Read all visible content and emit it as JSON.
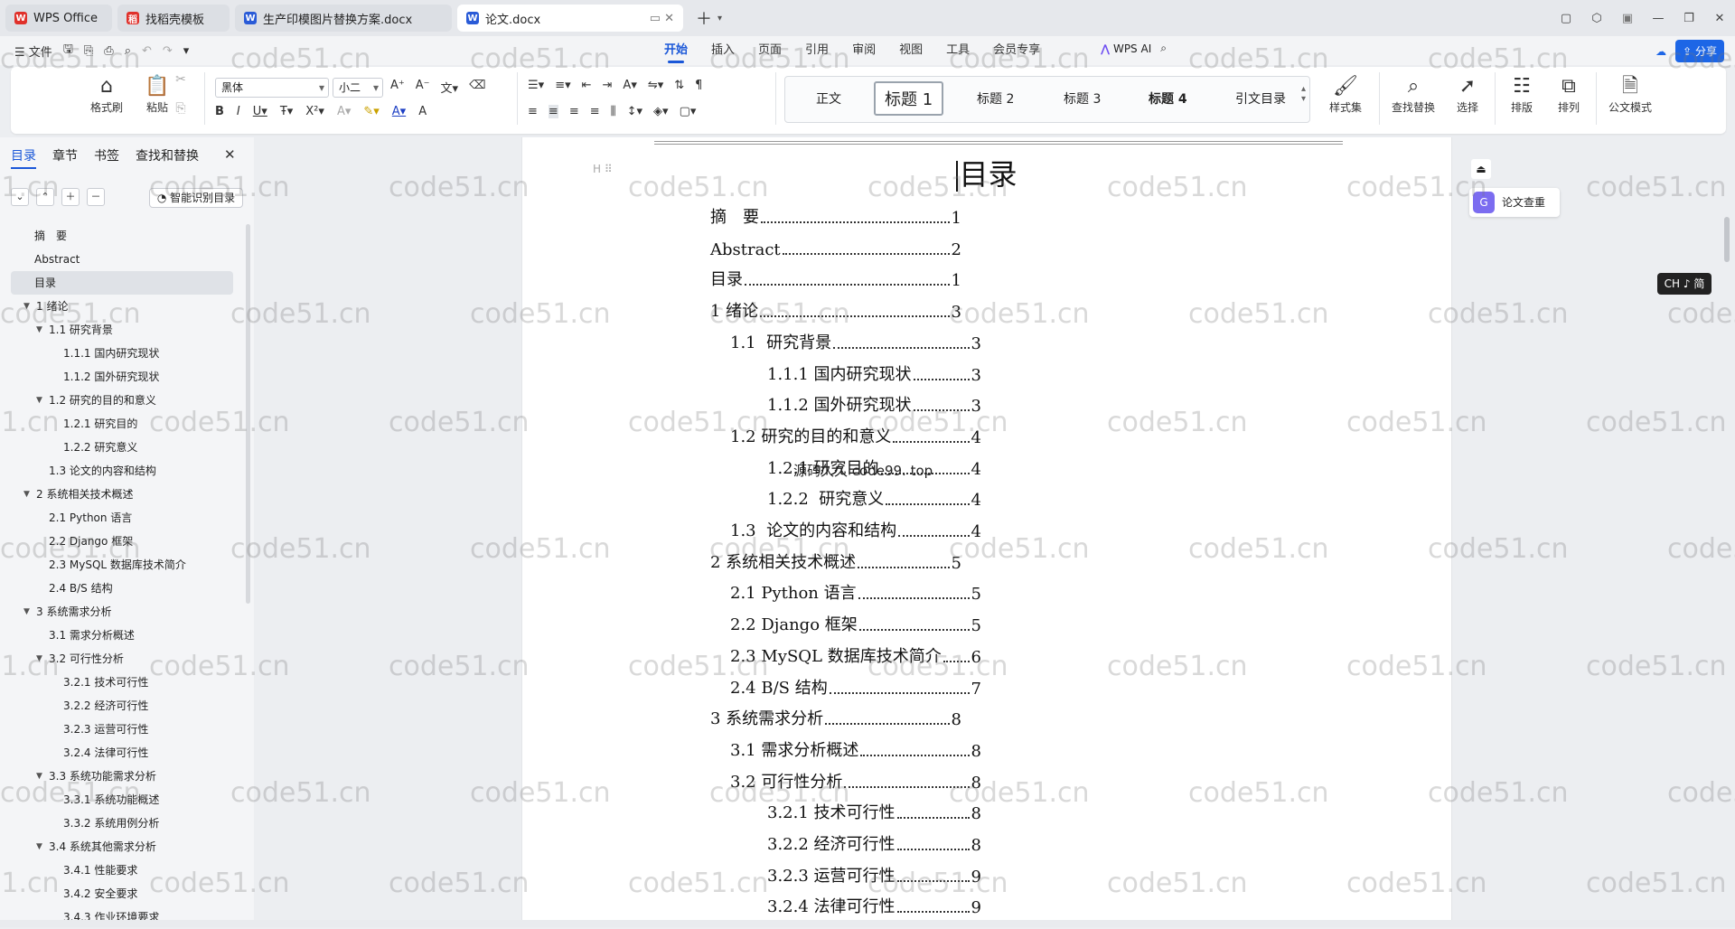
{
  "tabs": [
    {
      "label": "WPS Office",
      "icon": "W",
      "color": "#e0312b",
      "active": false
    },
    {
      "label": "找稻壳模板",
      "icon": "稻",
      "color": "#e0312b",
      "active": false
    },
    {
      "label": "生产印模图片替换方案.docx",
      "icon": "W",
      "color": "#2a5bd7",
      "active": false
    },
    {
      "label": "论文.docx",
      "icon": "W",
      "color": "#2a5bd7",
      "active": true
    }
  ],
  "menu": {
    "file": "文件",
    "ribbon_tabs": [
      "开始",
      "插入",
      "页面",
      "引用",
      "审阅",
      "视图",
      "工具",
      "会员专享"
    ],
    "wps_ai": "WPS AI",
    "share": "分享"
  },
  "ribbon": {
    "format_painter": "格式刷",
    "paste": "粘贴",
    "font_name": "黑体",
    "font_size": "小二",
    "styles": [
      "正文",
      "标题 1",
      "标题 2",
      "标题 3",
      "标题 4",
      "引文目录"
    ],
    "style_set": "样式集",
    "find_replace": "查找替换",
    "select": "选择",
    "layout": "排版",
    "arrange": "排列",
    "official": "公文模式"
  },
  "nav": {
    "tabs": [
      "目录",
      "章节",
      "书签",
      "查找和替换"
    ],
    "smart_btn": "智能识别目录",
    "items": [
      {
        "label": "摘　要",
        "level": 1,
        "toggle": false
      },
      {
        "label": "Abstract",
        "level": 1,
        "toggle": false
      },
      {
        "label": "目录",
        "level": 1,
        "toggle": false,
        "selected": true
      },
      {
        "label": "1 绪论",
        "level": 1,
        "toggle": true
      },
      {
        "label": "1.1  研究背景",
        "level": 2,
        "toggle": true
      },
      {
        "label": "1.1.1 国内研究现状",
        "level": 3,
        "toggle": false
      },
      {
        "label": "1.1.2 国外研究现状",
        "level": 3,
        "toggle": false
      },
      {
        "label": "1.2 研究的目的和意义",
        "level": 2,
        "toggle": true
      },
      {
        "label": "1.2.1 研究目的",
        "level": 3,
        "toggle": false
      },
      {
        "label": "1.2.2  研究意义",
        "level": 3,
        "toggle": false
      },
      {
        "label": "1.3  论文的内容和结构",
        "level": 2,
        "toggle": false
      },
      {
        "label": "2 系统相关技术概述",
        "level": 1,
        "toggle": true
      },
      {
        "label": "2.1 Python 语言",
        "level": 2,
        "toggle": false
      },
      {
        "label": "2.2 Django 框架",
        "level": 2,
        "toggle": false
      },
      {
        "label": "2.3 MySQL 数据库技术简介",
        "level": 2,
        "toggle": false
      },
      {
        "label": "2.4 B/S 结构",
        "level": 2,
        "toggle": false
      },
      {
        "label": "3 系统需求分析",
        "level": 1,
        "toggle": true
      },
      {
        "label": "3.1 需求分析概述",
        "level": 2,
        "toggle": false
      },
      {
        "label": "3.2 可行性分析",
        "level": 2,
        "toggle": true
      },
      {
        "label": "3.2.1 技术可行性",
        "level": 3,
        "toggle": false
      },
      {
        "label": "3.2.2 经济可行性",
        "level": 3,
        "toggle": false
      },
      {
        "label": "3.2.3 运营可行性",
        "level": 3,
        "toggle": false
      },
      {
        "label": "3.2.4 法律可行性",
        "level": 3,
        "toggle": false
      },
      {
        "label": "3.3 系统功能需求分析",
        "level": 2,
        "toggle": true
      },
      {
        "label": "3.3.1 系统功能概述",
        "level": 3,
        "toggle": false
      },
      {
        "label": "3.3.2 系统用例分析",
        "level": 3,
        "toggle": false
      },
      {
        "label": "3.4 系统其他需求分析",
        "level": 2,
        "toggle": true
      },
      {
        "label": "3.4.1 性能要求",
        "level": 3,
        "toggle": false
      },
      {
        "label": "3.4.2 安全要求",
        "level": 3,
        "toggle": false
      },
      {
        "label": "3.4.3 作业环境要求",
        "level": 3,
        "toggle": false
      }
    ]
  },
  "document": {
    "title": "目录",
    "heading_marker": "H",
    "toc": [
      {
        "label": "摘　要",
        "page": "1",
        "level": 0
      },
      {
        "label": "Abstract",
        "page": "2",
        "level": 0
      },
      {
        "label": "目录",
        "page": "1",
        "level": 0
      },
      {
        "label": "1 绪论",
        "page": "3",
        "level": 0
      },
      {
        "label": "1.1  研究背景",
        "page": "3",
        "level": 1
      },
      {
        "label": "1.1.1 国内研究现状",
        "page": "3",
        "level": 2
      },
      {
        "label": "1.1.2 国外研究现状",
        "page": "3",
        "level": 2
      },
      {
        "label": "1.2 研究的目的和意义",
        "page": "4",
        "level": 1
      },
      {
        "label": "1.2.1 研究目的",
        "page": "4",
        "level": 2
      },
      {
        "label": "1.2.2  研究意义",
        "page": "4",
        "level": 2
      },
      {
        "label": "1.3  论文的内容和结构",
        "page": "4",
        "level": 1
      },
      {
        "label": "2 系统相关技术概述",
        "page": "5",
        "level": 0
      },
      {
        "label": "2.1 Python 语言",
        "page": "5",
        "level": 1
      },
      {
        "label": "2.2 Django 框架",
        "page": "5",
        "level": 1
      },
      {
        "label": "2.3 MySQL 数据库技术简介",
        "page": "6",
        "level": 1
      },
      {
        "label": "2.4 B/S 结构",
        "page": "7",
        "level": 1
      },
      {
        "label": "3 系统需求分析",
        "page": "8",
        "level": 0
      },
      {
        "label": "3.1 需求分析概述",
        "page": "8",
        "level": 1
      },
      {
        "label": "3.2 可行性分析",
        "page": "8",
        "level": 1
      },
      {
        "label": "3.2.1 技术可行性",
        "page": "8",
        "level": 2
      },
      {
        "label": "3.2.2 经济可行性",
        "page": "8",
        "level": 2
      },
      {
        "label": "3.2.3 运营可行性",
        "page": "9",
        "level": 2
      },
      {
        "label": "3.2.4 法律可行性",
        "page": "9",
        "level": 2
      }
    ],
    "overlay_text": "源码久久 code99. top"
  },
  "right": {
    "paper_check": "论文查重",
    "ime": "CH ♪ 简"
  },
  "watermark": "code51.cn"
}
